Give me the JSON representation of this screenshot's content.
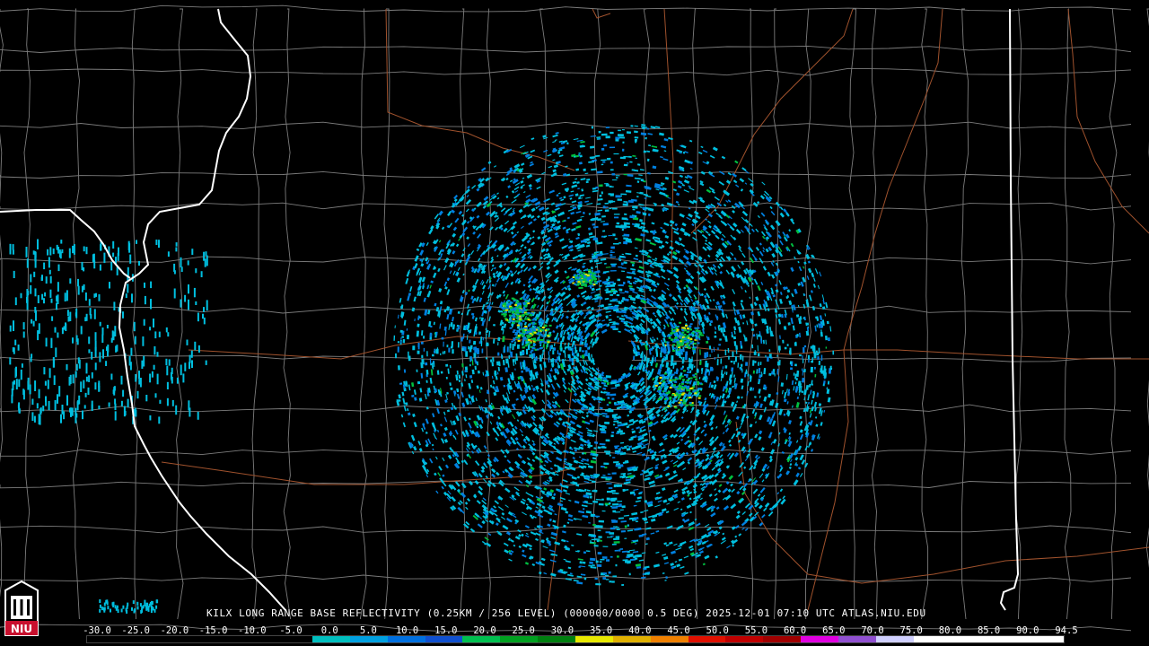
{
  "caption": "KILX LONG RANGE BASE REFLECTIVITY (0.25KM / 256 LEVEL) (000000/0000 0.5 DEG) 2025-12-01 07:10 UTC  ATLAS.NIU.EDU",
  "scale": {
    "labels": [
      "-30.0",
      "-25.0",
      "-20.0",
      "-15.0",
      "-10.0",
      "-5.0",
      "0.0",
      "5.0",
      "10.0",
      "15.0",
      "20.0",
      "25.0",
      "30.0",
      "35.0",
      "40.0",
      "45.0",
      "50.0",
      "55.0",
      "60.0",
      "65.0",
      "70.0",
      "75.0",
      "80.0",
      "85.0",
      "90.0",
      "94.5"
    ],
    "colors": [
      "#000000",
      "#000000",
      "#000000",
      "#000000",
      "#000000",
      "#000000",
      "#00bfbf",
      "#00a0e0",
      "#0070e0",
      "#1050d0",
      "#00c050",
      "#00a020",
      "#008010",
      "#e8e800",
      "#e0b000",
      "#f08000",
      "#e01000",
      "#c00000",
      "#a00000",
      "#e000e0",
      "#9050d0",
      "#d0d0ff",
      "#ffffff",
      "#ffffff",
      "#ffffff",
      "#ffffff"
    ]
  },
  "logo_text": "NIU",
  "colors": {
    "background": "#000000",
    "county": "#7a7a7a",
    "highway": "#a0522d",
    "state": "#ffffff",
    "echo_light": "#00bfdf",
    "echo_mid": "#0080e0",
    "echo_strong": "#00c040",
    "echo_yellow": "#e0e000"
  }
}
